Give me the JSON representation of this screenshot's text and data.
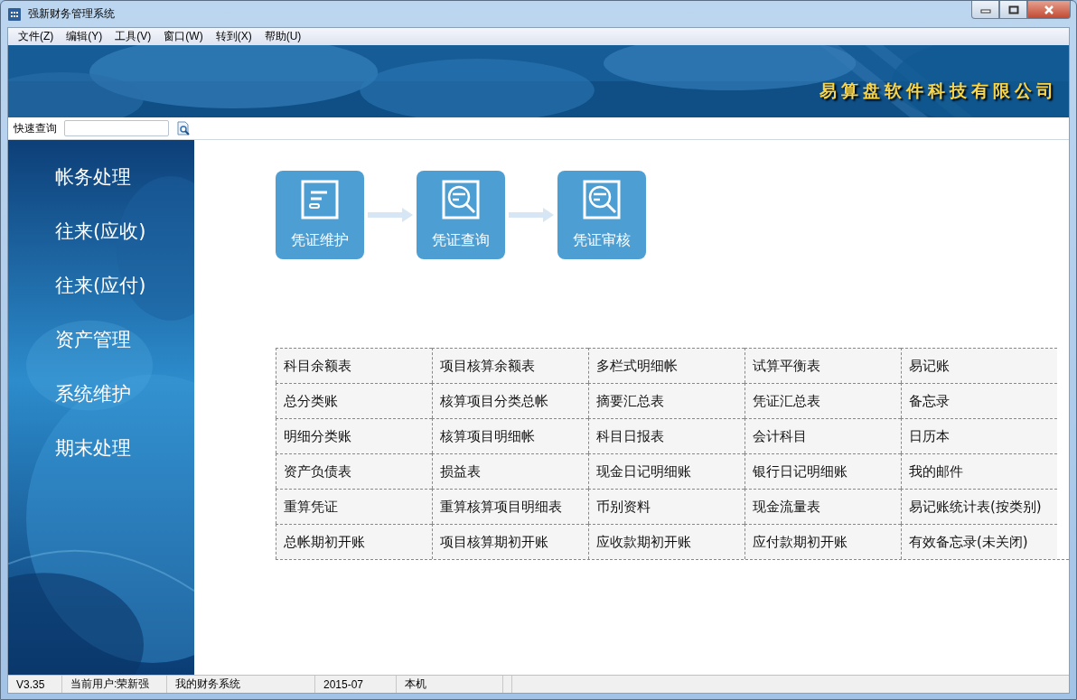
{
  "window": {
    "title": "强新财务管理系统"
  },
  "menu": [
    "文件(Z)",
    "编辑(Y)",
    "工具(V)",
    "窗口(W)",
    "转到(X)",
    "帮助(U)"
  ],
  "banner": {
    "company": "易算盘软件科技有限公司"
  },
  "quick_search": {
    "label": "快速查询"
  },
  "sidebar": {
    "items": [
      {
        "label": "帐务处理"
      },
      {
        "label": "往来(应收)"
      },
      {
        "label": "往来(应付)"
      },
      {
        "label": "资产管理"
      },
      {
        "label": "系统维护"
      },
      {
        "label": "期末处理"
      }
    ]
  },
  "flow": [
    {
      "label": "凭证维护",
      "kind": "edit"
    },
    {
      "label": "凭证查询",
      "kind": "search"
    },
    {
      "label": "凭证审核",
      "kind": "search"
    }
  ],
  "links": [
    [
      "科目余额表",
      "项目核算余额表",
      "多栏式明细帐",
      "试算平衡表",
      "易记账"
    ],
    [
      "总分类账",
      "核算项目分类总帐",
      "摘要汇总表",
      "凭证汇总表",
      "备忘录"
    ],
    [
      "明细分类账",
      "核算项目明细帐",
      "科目日报表",
      "会计科目",
      "日历本"
    ],
    [
      "资产负债表",
      "损益表",
      "现金日记明细账",
      "银行日记明细账",
      "我的邮件"
    ],
    [
      "重算凭证",
      "重算核算项目明细表",
      "币别资料",
      "现金流量表",
      "易记账统计表(按类别)"
    ],
    [
      "总帐期初开账",
      "项目核算期初开账",
      "应收款期初开账",
      "应付款期初开账",
      "有效备忘录(未关闭)"
    ]
  ],
  "status_bar": [
    "V3.35",
    "当前用户:荣新强",
    "我的财务系统",
    "2015-07",
    "本机"
  ]
}
